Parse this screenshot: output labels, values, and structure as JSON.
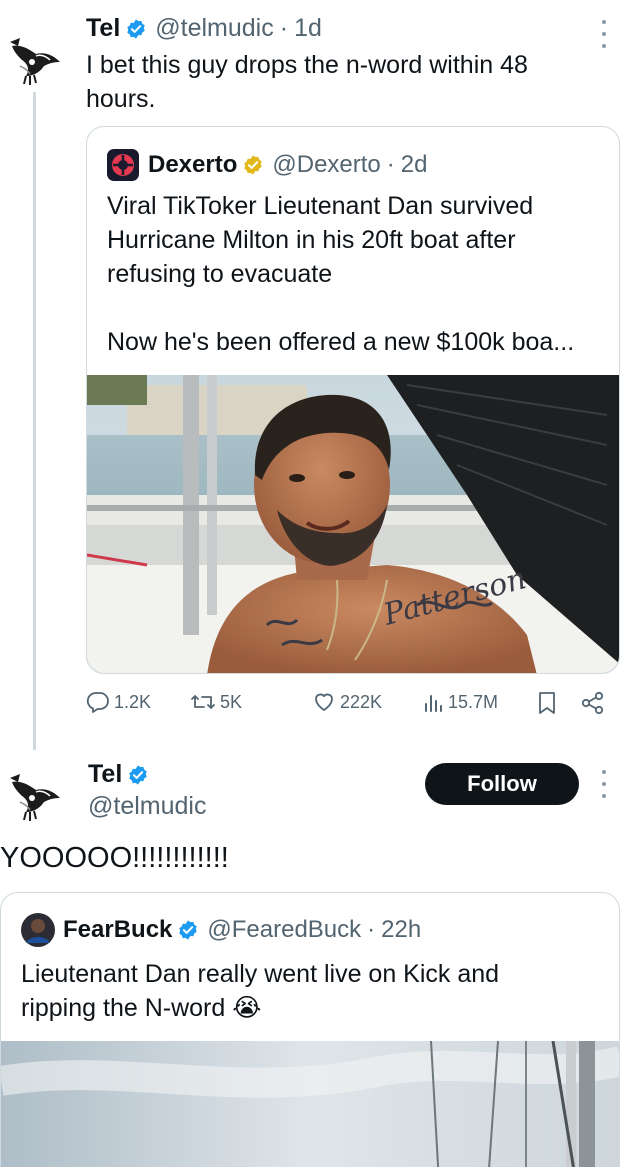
{
  "tweet1": {
    "author_name": "Tel",
    "author_handle": "@telmudic",
    "separator": "·",
    "time": "1d",
    "text": "I bet this guy drops the n-word within 48 hours.",
    "quote": {
      "author_name": "Dexerto",
      "author_handle": "@Dexerto",
      "separator": "·",
      "time": "2d",
      "text": "Viral TikToker Lieutenant Dan survived Hurricane Milton in his 20ft boat after refusing to evacuate\n\nNow he's been offered a new $100k boa...",
      "tattoo_text": "Patterson"
    },
    "actions": {
      "replies": "1.2K",
      "reposts": "5K",
      "likes": "222K",
      "views": "15.7M"
    }
  },
  "tweet2": {
    "author_name": "Tel",
    "author_handle": "@telmudic",
    "follow_label": "Follow",
    "text": "YOOOOO!!!!!!!!!!!!",
    "quote": {
      "author_name": "FearBuck",
      "author_handle": "@FearedBuck",
      "separator": "·",
      "time": "22h",
      "text": "Lieutenant Dan really went live on Kick and ripping the N-word",
      "emoji": "😭"
    }
  },
  "colors": {
    "verified_blue": "#1d9bf0",
    "verified_gold": "#e2b719",
    "text_primary": "#0f1419",
    "text_secondary": "#536471",
    "border": "#cfd9de",
    "follow_bg": "#0f1419"
  },
  "icons": [
    "crow-avatar",
    "dexerto-logo",
    "verified-badge",
    "reply-icon",
    "repost-icon",
    "like-icon",
    "views-icon",
    "bookmark-icon",
    "share-icon",
    "more-icon"
  ]
}
